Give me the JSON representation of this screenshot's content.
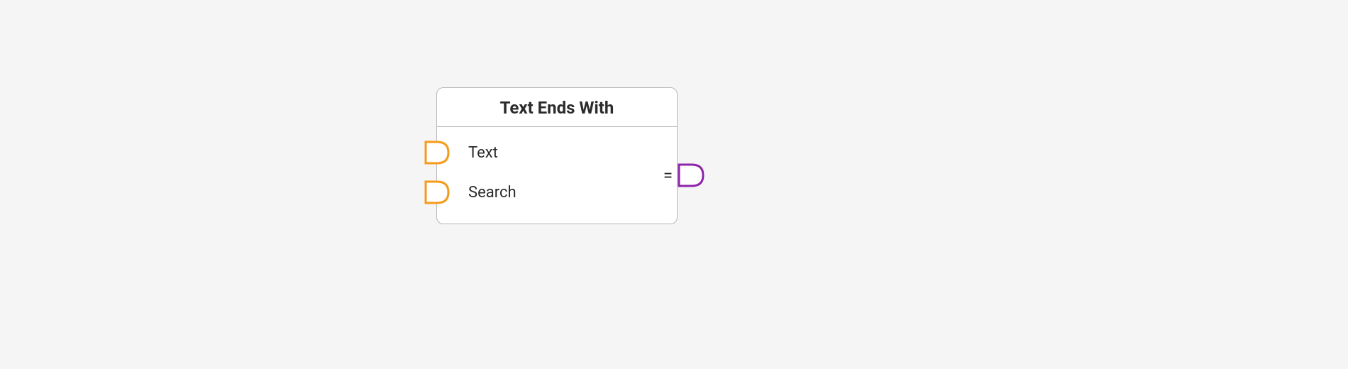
{
  "node": {
    "title": "Text Ends With",
    "inputs": [
      {
        "label": "Text",
        "port_color": "#f59b1a"
      },
      {
        "label": "Search",
        "port_color": "#f59b1a"
      }
    ],
    "output": {
      "label": "=",
      "port_color": "#8e24aa"
    }
  }
}
